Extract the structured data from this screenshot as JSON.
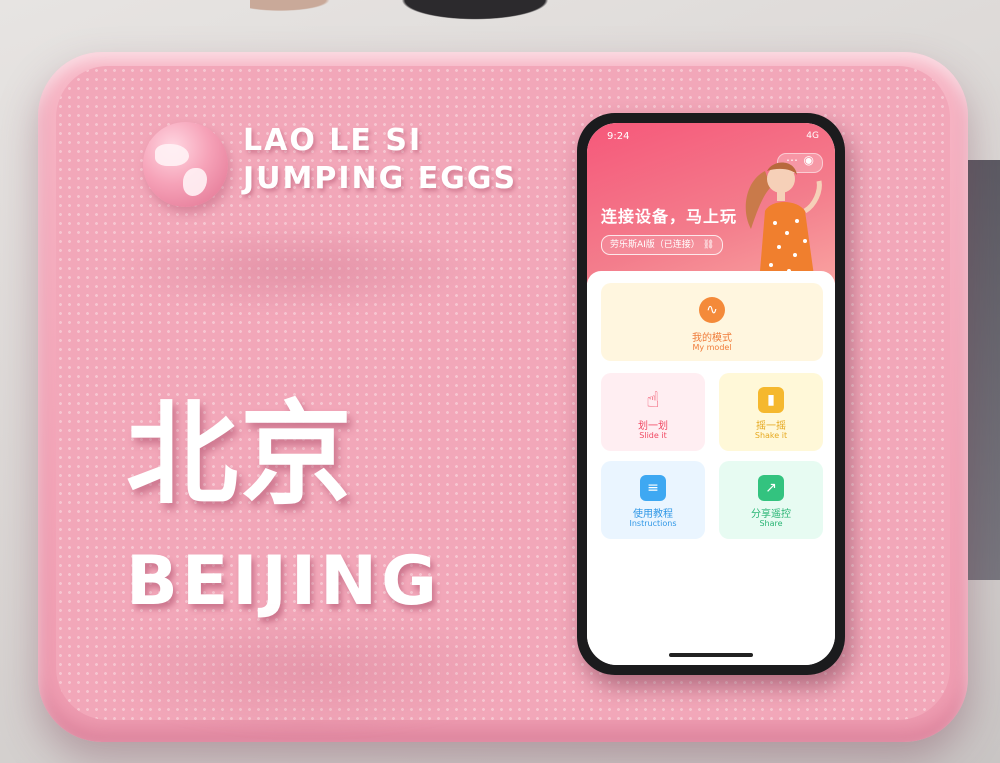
{
  "brand": {
    "line1": "LAO LE SI",
    "line2": "JUMPING EGGS"
  },
  "city": {
    "zh": "北京",
    "en": "BEIJING"
  },
  "phone": {
    "status_time": "9:24",
    "status_network": "4G",
    "hero_title": "连接设备，马上玩",
    "device_chip": "劳乐斯AI版（已连接）",
    "cards": {
      "mode": {
        "zh": "我的模式",
        "en": "My model",
        "icon": "waveform-icon"
      },
      "slide": {
        "zh": "划一划",
        "en": "Slide it",
        "icon": "hand-pointer-icon"
      },
      "shake": {
        "zh": "摇一摇",
        "en": "Shake it",
        "icon": "phone-shake-icon"
      },
      "instructions": {
        "zh": "使用教程",
        "en": "Instructions",
        "icon": "document-icon"
      },
      "share": {
        "zh": "分享遥控",
        "en": "Share",
        "icon": "share-icon"
      }
    }
  },
  "colors": {
    "board_pink": "#f3a5b8",
    "hero_red": "#f6587a",
    "mode_orange": "#f07c3a",
    "slide_red": "#f04a64",
    "shake_yellow": "#e6a921",
    "instructions_blue": "#2f97e6",
    "share_green": "#2ab575"
  }
}
